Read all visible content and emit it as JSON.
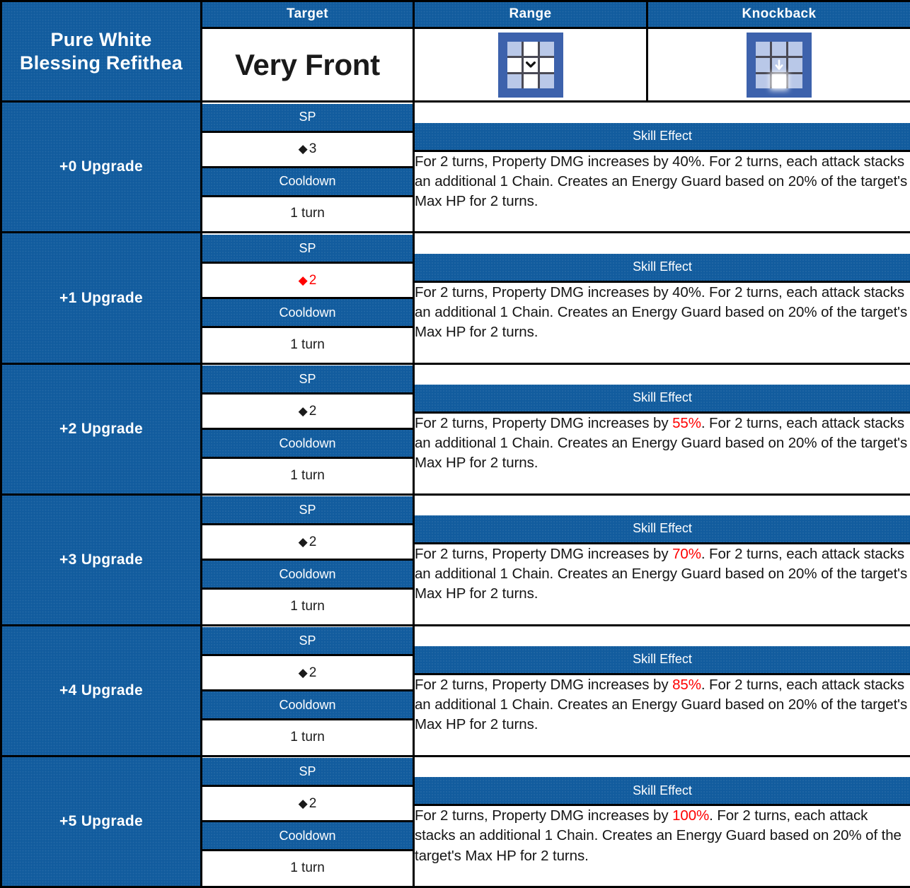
{
  "skill": {
    "name": "Pure White\nBlessing Refithea",
    "name_line1": "Pure White",
    "name_line2": "Blessing Refithea"
  },
  "columns": {
    "target_label": "Target",
    "range_label": "Range",
    "knockback_label": "Knockback"
  },
  "header_values": {
    "target_value": "Very Front",
    "range_icon": "range-grid-icon",
    "knockback_icon": "knockback-grid-icon"
  },
  "sub_headers": {
    "sp": "SP",
    "cooldown": "Cooldown",
    "skill_effect": "Skill Effect"
  },
  "colors": {
    "header_blue": "#125C9E",
    "highlight_red": "#FF0000",
    "icon_frame": "#3D62AC",
    "icon_cell": "#B9C8E8",
    "icon_active": "#FFFFFF",
    "text_dark": "#151515"
  },
  "upgrades": [
    {
      "label": "+0 Upgrade",
      "sp_diamond": "◆",
      "sp_value": "3",
      "sp_is_red": false,
      "cooldown_value": "1 turn",
      "effect_pre": "For 2 turns, Property DMG increases by ",
      "effect_pct": "40%",
      "effect_pct_red": false,
      "effect_post": ". For 2 turns, each attack stacks an additional 1 Chain. Creates an Energy Guard based on 20% of the target's Max HP for 2 turns."
    },
    {
      "label": "+1 Upgrade",
      "sp_diamond": "◆",
      "sp_value": "2",
      "sp_is_red": true,
      "cooldown_value": "1 turn",
      "effect_pre": "For 2 turns, Property DMG increases by ",
      "effect_pct": "40%",
      "effect_pct_red": false,
      "effect_post": ". For 2 turns, each attack stacks an additional 1 Chain. Creates an Energy Guard based on 20% of the target's Max HP for 2 turns."
    },
    {
      "label": "+2 Upgrade",
      "sp_diamond": "◆",
      "sp_value": "2",
      "sp_is_red": false,
      "cooldown_value": "1 turn",
      "effect_pre": "For 2 turns, Property DMG increases by ",
      "effect_pct": "55%",
      "effect_pct_red": true,
      "effect_post": ". For 2 turns, each attack stacks an additional 1 Chain. Creates an Energy Guard based on 20% of the target's Max HP for 2 turns."
    },
    {
      "label": "+3 Upgrade",
      "sp_diamond": "◆",
      "sp_value": "2",
      "sp_is_red": false,
      "cooldown_value": "1 turn",
      "effect_pre": "For 2 turns, Property DMG increases by ",
      "effect_pct": "70%",
      "effect_pct_red": true,
      "effect_post": ". For 2 turns, each attack stacks an additional 1 Chain. Creates an Energy Guard based on 20% of the target's Max HP for 2 turns."
    },
    {
      "label": "+4 Upgrade",
      "sp_diamond": "◆",
      "sp_value": "2",
      "sp_is_red": false,
      "cooldown_value": "1 turn",
      "effect_pre": "For 2 turns, Property DMG increases by ",
      "effect_pct": "85%",
      "effect_pct_red": true,
      "effect_post": ". For 2 turns, each attack stacks an additional 1 Chain. Creates an Energy Guard based on 20% of the target's Max HP for 2 turns."
    },
    {
      "label": "+5 Upgrade",
      "sp_diamond": "◆",
      "sp_value": "2",
      "sp_is_red": false,
      "cooldown_value": "1 turn",
      "effect_pre": "For 2 turns, Property DMG increases by ",
      "effect_pct": "100%",
      "effect_pct_red": true,
      "effect_post": ". For 2 turns, each attack stacks an additional 1 Chain. Creates an Energy Guard based on 20% of the target's Max HP for 2 turns."
    }
  ]
}
